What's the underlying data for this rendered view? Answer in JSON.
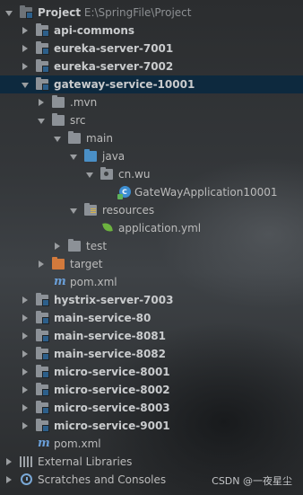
{
  "project": {
    "name": "Project",
    "path": "E:\\SpringFile\\Project"
  },
  "modules": {
    "api_commons": "api-commons",
    "eureka_7001": "eureka-server-7001",
    "eureka_7002": "eureka-server-7002",
    "gateway": "gateway-service-10001",
    "hystrix": "hystrix-server-7003",
    "main_80": "main-service-80",
    "main_8081": "main-service-8081",
    "main_8082": "main-service-8082",
    "micro_8001": "micro-service-8001",
    "micro_8002": "micro-service-8002",
    "micro_8003": "micro-service-8003",
    "micro_9001": "micro-service-9001"
  },
  "gateway_tree": {
    "mvn": ".mvn",
    "src": "src",
    "main": "main",
    "java": "java",
    "package": "cn.wu",
    "app_class": "GateWayApplication10001",
    "resources": "resources",
    "yml": "application.yml",
    "test": "test",
    "target": "target",
    "pom": "pom.xml"
  },
  "root_pom": "pom.xml",
  "external_libraries": "External Libraries",
  "scratches": "Scratches and Consoles",
  "watermark": "CSDN @一夜星尘",
  "colors": {
    "selection": "#0d293e",
    "module_folder": "#8c9197",
    "source_folder": "#4a8fc6",
    "target_folder": "#d37a3c",
    "spring_green": "#6db33f",
    "maven_blue": "#6a9fd8"
  },
  "icons": [
    "folder-icon",
    "module-folder-icon",
    "source-folder-icon",
    "resources-folder-icon",
    "excluded-folder-icon",
    "package-icon",
    "spring-boot-class-icon",
    "spring-yml-icon",
    "maven-icon",
    "library-icon",
    "scratches-icon"
  ]
}
